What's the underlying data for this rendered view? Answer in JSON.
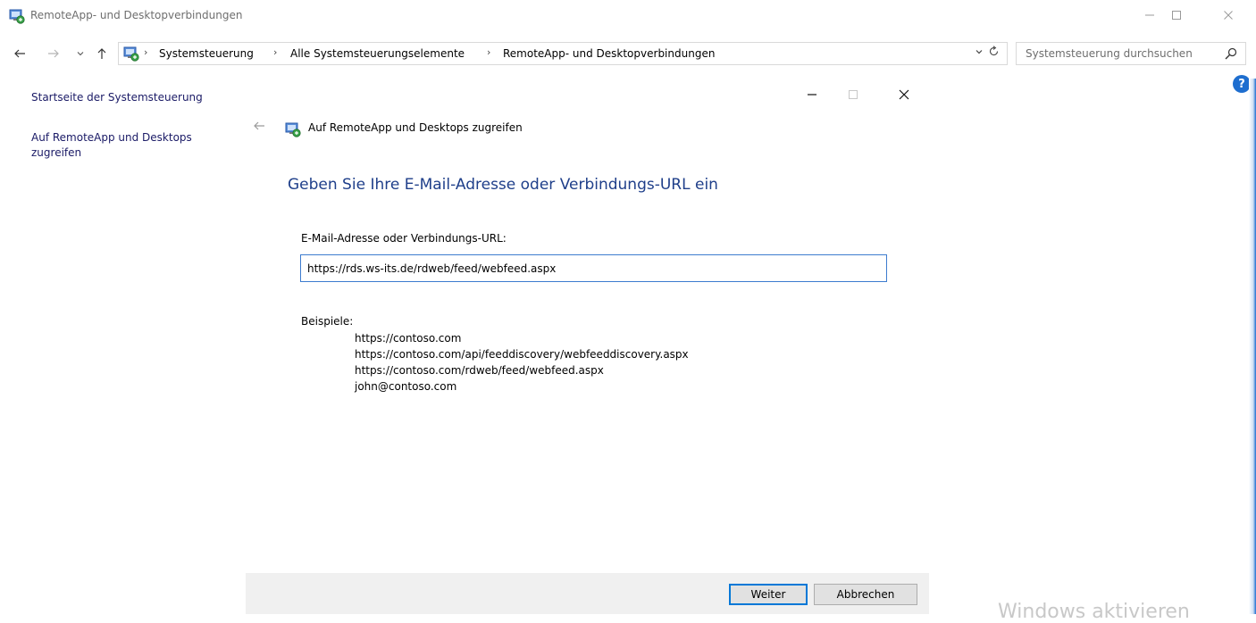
{
  "window": {
    "title": "RemoteApp- und Desktopverbindungen",
    "icon": "remoteapp-icon"
  },
  "address": {
    "breadcrumbs": [
      "Systemsteuerung",
      "Alle Systemsteuerungselemente",
      "RemoteApp- und Desktopverbindungen"
    ]
  },
  "search": {
    "placeholder": "Systemsteuerung durchsuchen"
  },
  "sidebar": {
    "items": [
      {
        "label": "Startseite der Systemsteuerung"
      },
      {
        "label": "Auf RemoteApp und Desktops zugreifen"
      }
    ]
  },
  "wizard": {
    "title": "Auf RemoteApp und Desktops zugreifen",
    "heading": "Geben Sie Ihre E-Mail-Adresse oder Verbindungs-URL ein",
    "field_label": "E-Mail-Adresse oder Verbindungs-URL:",
    "field_value": "https://rds.ws-its.de/rdweb/feed/webfeed.aspx",
    "examples_label": "Beispiele:",
    "examples": [
      "https://contoso.com",
      "https://contoso.com/api/feeddiscovery/webfeeddiscovery.aspx",
      "https://contoso.com/rdweb/feed/webfeed.aspx",
      "john@contoso.com"
    ],
    "next_label": "Weiter",
    "cancel_label": "Abbrechen"
  },
  "watermark": "Windows aktivieren",
  "colors": {
    "accent": "#0078d7",
    "heading": "#1f3f8a",
    "link": "#1a1a66"
  }
}
